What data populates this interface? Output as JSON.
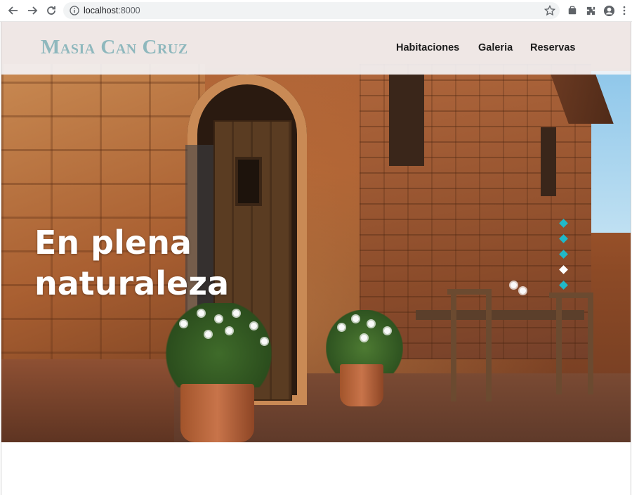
{
  "browser": {
    "url_host": "localhost",
    "url_port": ":8000"
  },
  "site": {
    "logo": "Masia Can Cruz",
    "nav": [
      "Habitaciones",
      "Galeria",
      "Reservas"
    ]
  },
  "hero": {
    "headline_line1": "En plena",
    "headline_line2": "naturaleza",
    "slides": [
      {
        "active": false,
        "color": "#20b8c8"
      },
      {
        "active": false,
        "color": "#20b8c8"
      },
      {
        "active": false,
        "color": "#20b8c8"
      },
      {
        "active": true,
        "color": "#ffffff"
      },
      {
        "active": false,
        "color": "#20b8c8"
      }
    ]
  }
}
